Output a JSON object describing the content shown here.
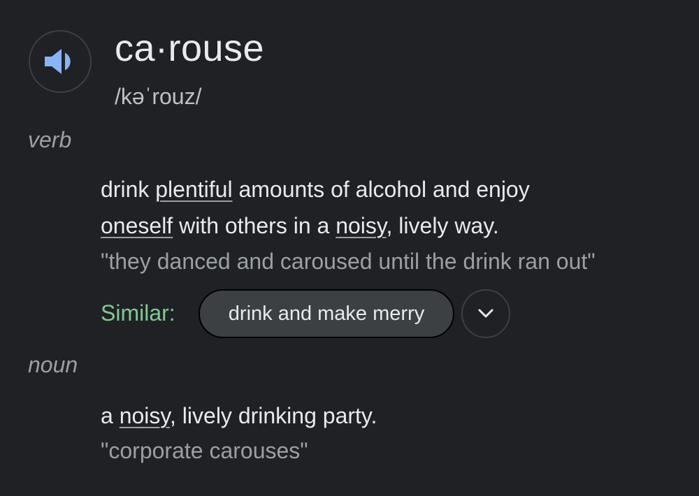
{
  "entry": {
    "headword": "ca·rouse",
    "phonetic": "/kəˈrouz/",
    "speaker_icon": "volume-up-icon"
  },
  "senses": [
    {
      "part_of_speech": "verb",
      "definition": {
        "pre": "drink ",
        "link1": "plentiful",
        "mid1": " amounts of alcohol and enjoy ",
        "link2": "oneself",
        "mid2": " with others in a ",
        "link3": "noisy",
        "post": ", lively way."
      },
      "example": "\"they danced and caroused until the drink ran out\"",
      "similar": {
        "label": "Similar:",
        "chips": [
          "drink and make merry"
        ],
        "expand_icon": "chevron-down-icon"
      }
    },
    {
      "part_of_speech": "noun",
      "definition": {
        "pre": "a ",
        "link1": "noisy",
        "post": ", lively drinking party."
      },
      "example": "\"corporate carouses\""
    }
  ],
  "colors": {
    "background": "#202124",
    "text_primary": "#e8eaed",
    "text_secondary": "#9aa0a6",
    "similar_label": "#81c995",
    "speaker_icon": "#8ab4f8",
    "chip_background": "#3c4043"
  }
}
